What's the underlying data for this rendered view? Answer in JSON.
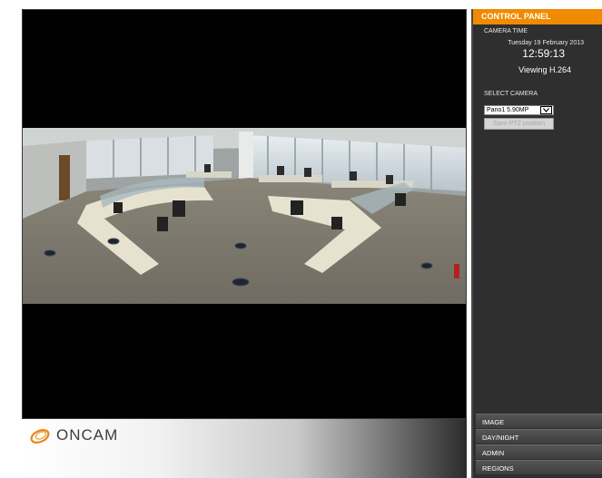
{
  "brand": {
    "logo_text": "ONCAM",
    "accent_color": "#f08a00"
  },
  "control_panel": {
    "title": "CONTROL PANEL",
    "camera_time_label": "CAMERA TIME",
    "date": "Tuesday 19 February 2013",
    "time": "12:59:13",
    "viewing": "Viewing H.264",
    "select_camera_label": "SELECT CAMERA",
    "selected_camera": "Pano1 5.90MP",
    "ptz_button_label": "Save PTZ position"
  },
  "tabs": [
    {
      "label": "IMAGE"
    },
    {
      "label": "DAY/NIGHT"
    },
    {
      "label": "ADMIN"
    },
    {
      "label": "REGIONS"
    }
  ],
  "icons": {
    "logo_mark": "oncam-swirl-icon",
    "dropdown": "chevron-down-icon"
  }
}
